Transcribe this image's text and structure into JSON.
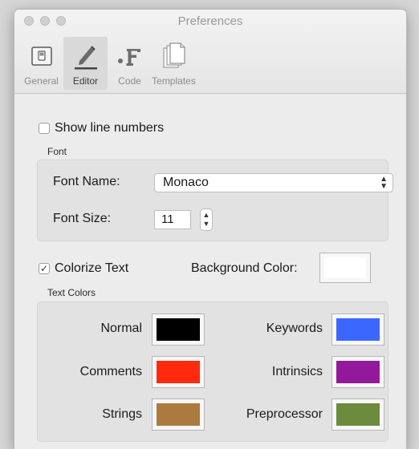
{
  "window": {
    "title": "Preferences"
  },
  "toolbar": {
    "items": [
      {
        "label": "General",
        "icon": "general-switch-icon"
      },
      {
        "label": "Editor",
        "icon": "pencil-icon",
        "selected": true
      },
      {
        "label": "Code",
        "icon": "dot-f-icon"
      },
      {
        "label": "Templates",
        "icon": "documents-icon"
      }
    ]
  },
  "editor": {
    "show_line_numbers": {
      "label": "Show line numbers",
      "checked": false
    },
    "font": {
      "group_label": "Font",
      "font_name_label": "Font Name:",
      "font_name_value": "Monaco",
      "font_size_label": "Font Size:",
      "font_size_value": "11"
    },
    "colorize_text": {
      "label": "Colorize Text",
      "checked": true,
      "check_mark": "✓"
    },
    "background_color": {
      "label": "Background Color:",
      "color": "#ffffff"
    },
    "text_colors": {
      "group_label": "Text Colors",
      "items": [
        {
          "label": "Normal",
          "color": "#000000"
        },
        {
          "label": "Keywords",
          "color": "#3c67ff"
        },
        {
          "label": "Comments",
          "color": "#ff2a0e"
        },
        {
          "label": "Intrinsics",
          "color": "#93199b"
        },
        {
          "label": "Strings",
          "color": "#ac7a3f"
        },
        {
          "label": "Preprocessor",
          "color": "#6c8b3c"
        }
      ]
    }
  }
}
